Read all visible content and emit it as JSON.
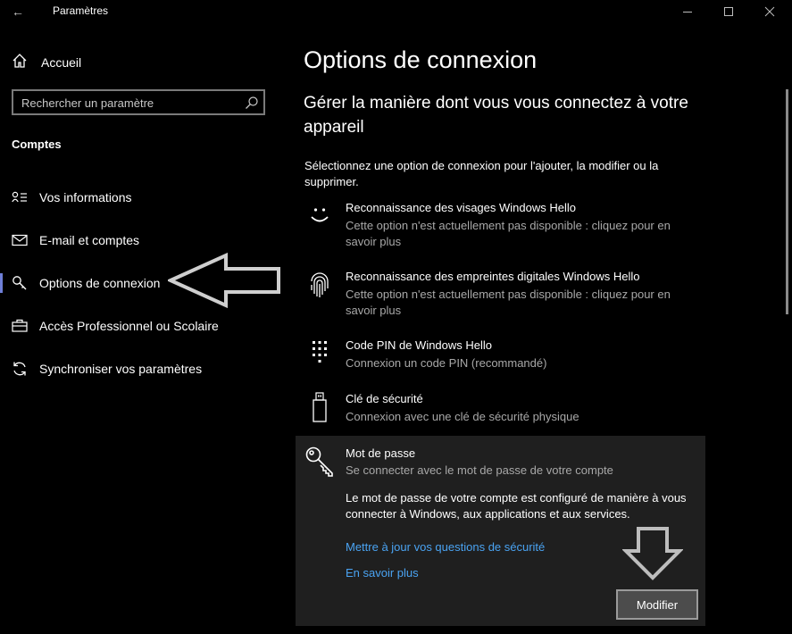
{
  "window": {
    "title": "Paramètres",
    "back_icon": "back-arrow-icon",
    "minimize_icon": "minimize-icon",
    "maximize_icon": "maximize-icon",
    "close_icon": "close-icon"
  },
  "sidebar": {
    "home_label": "Accueil",
    "home_icon": "home-icon",
    "search": {
      "placeholder": "Rechercher un paramètre",
      "icon": "search-icon"
    },
    "section_label": "Comptes",
    "items": [
      {
        "label": "Vos informations",
        "icon": "person-card-icon",
        "selected": false
      },
      {
        "label": "E-mail et comptes",
        "icon": "mail-icon",
        "selected": false
      },
      {
        "label": "Options de connexion",
        "icon": "key-icon",
        "selected": true
      },
      {
        "label": "Accès Professionnel ou Scolaire",
        "icon": "briefcase-icon",
        "selected": false
      },
      {
        "label": "Synchroniser vos paramètres",
        "icon": "sync-icon",
        "selected": false
      }
    ]
  },
  "main": {
    "title": "Options de connexion",
    "subtitle": "Gérer la manière dont vous vous connectez à votre appareil",
    "intro": "Sélectionnez une option de connexion pour l'ajouter, la modifier ou la supprimer.",
    "options": [
      {
        "title": "Reconnaissance des visages Windows Hello",
        "description": "Cette option n'est actuellement pas disponible : cliquez pour en savoir plus",
        "icon": "smiley-face-icon"
      },
      {
        "title": "Reconnaissance des empreintes digitales Windows Hello",
        "description": "Cette option n'est actuellement pas disponible : cliquez pour en savoir plus",
        "icon": "fingerprint-icon"
      },
      {
        "title": "Code PIN de Windows Hello",
        "description": "Connexion un code PIN (recommandé)",
        "icon": "keypad-icon"
      },
      {
        "title": "Clé de sécurité",
        "description": "Connexion avec une clé de sécurité physique",
        "icon": "usb-key-icon"
      }
    ],
    "password": {
      "title": "Mot de passe",
      "description": "Se connecter avec le mot de passe de votre compte",
      "icon": "password-key-icon",
      "body": "Le mot de passe de votre compte est configuré de manière à vous connecter à Windows, aux applications et aux services.",
      "link_security_questions": "Mettre à jour vos questions de sécurité",
      "link_learn_more": "En savoir plus",
      "modify_label": "Modifier"
    }
  },
  "annotations": {
    "arrow_left_icon": "left-arrow-annotation-icon",
    "arrow_down_icon": "down-arrow-annotation-icon"
  },
  "colors": {
    "background": "#000000",
    "panel": "#1f1f1f",
    "link": "#4aa3f2",
    "accent": "#6f7fd8",
    "secondary_text": "#a8a8a8"
  }
}
